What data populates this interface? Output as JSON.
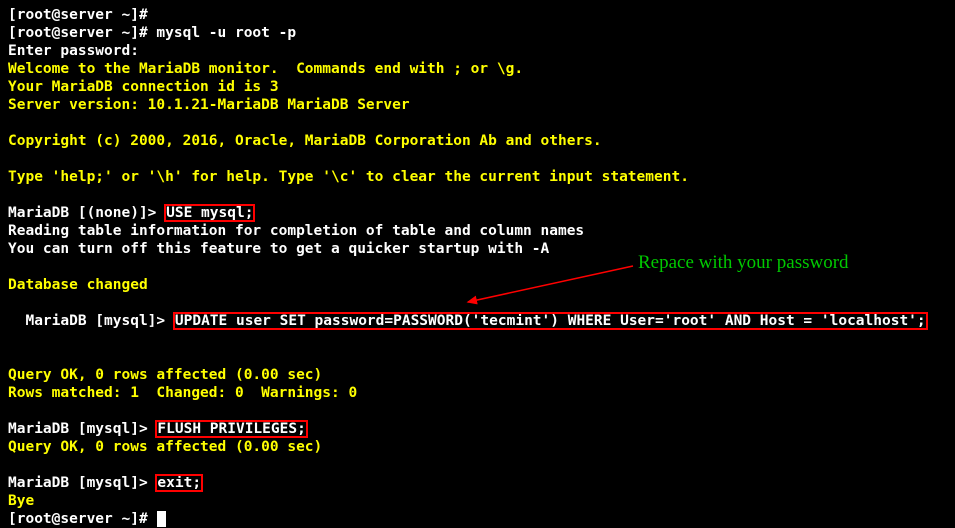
{
  "annotation": {
    "text": "Repace with your password"
  },
  "l1": {
    "prompt": "[root@server ~]#"
  },
  "l2": {
    "prompt": "[root@server ~]# ",
    "cmd": "mysql -u root -p"
  },
  "l3": {
    "text": "Enter password:"
  },
  "l4": {
    "text": "Welcome to the MariaDB monitor.  Commands end with ; or \\g."
  },
  "l5": {
    "text": "Your MariaDB connection id is 3"
  },
  "l6": {
    "text": "Server version: 10.1.21-MariaDB MariaDB Server"
  },
  "l8": {
    "text": "Copyright (c) 2000, 2016, Oracle, MariaDB Corporation Ab and others."
  },
  "l10": {
    "text": "Type 'help;' or '\\h' for help. Type '\\c' to clear the current input statement."
  },
  "l12": {
    "prompt": "MariaDB [(none)]> ",
    "cmd": "USE mysql;"
  },
  "l13": {
    "text": "Reading table information for completion of table and column names"
  },
  "l14": {
    "text": "You can turn off this feature to get a quicker startup with -A"
  },
  "l16": {
    "text": "Database changed"
  },
  "l17": {
    "prompt": "MariaDB [mysql]> ",
    "cmd": "UPDATE user SET password=PASSWORD('tecmint') WHERE User='root' AND Host = 'localhost';"
  },
  "l18": {
    "text": "Query OK, 0 rows affected (0.00 sec)"
  },
  "l19": {
    "text": "Rows matched: 1  Changed: 0  Warnings: 0"
  },
  "l21": {
    "prompt": "MariaDB [mysql]> ",
    "cmd": "FLUSH PRIVILEGES;"
  },
  "l22": {
    "text": "Query OK, 0 rows affected (0.00 sec)"
  },
  "l24": {
    "prompt": "MariaDB [mysql]> ",
    "cmd": "exit;"
  },
  "l25": {
    "text": "Bye"
  },
  "l26": {
    "prompt": "[root@server ~]# "
  }
}
